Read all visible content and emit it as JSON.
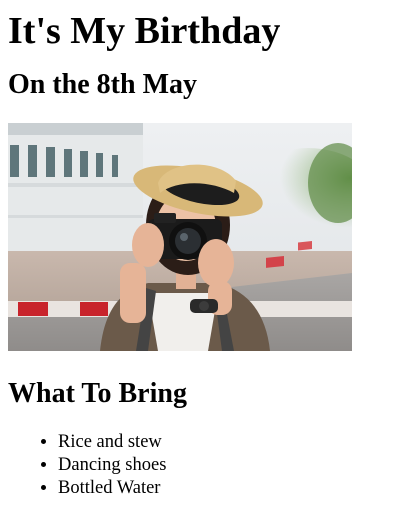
{
  "page": {
    "title": "It's My Birthday",
    "subtitle": "On the 8th May",
    "photo_icon": "photographer-with-camera-photo",
    "section_heading": "What To Bring",
    "bring_items": [
      "Rice and stew",
      "Dancing shoes",
      "Bottled Water"
    ]
  }
}
